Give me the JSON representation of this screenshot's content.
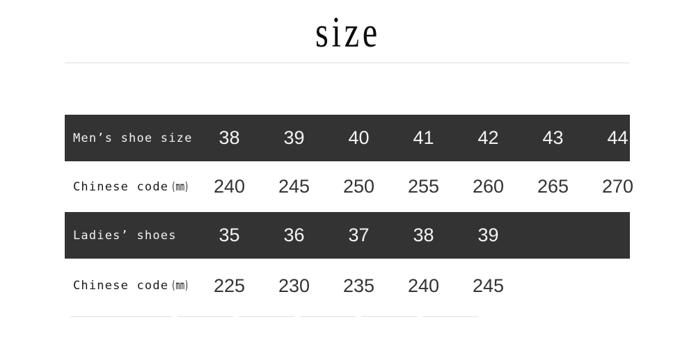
{
  "header": {
    "title": "size"
  },
  "table": {
    "rows": [
      {
        "style": "dark",
        "label": "Men’s shoe size",
        "unit": "",
        "values": [
          "38",
          "39",
          "40",
          "41",
          "42",
          "43",
          "44"
        ]
      },
      {
        "style": "light",
        "label": "Chinese code",
        "unit": "(mm)",
        "values": [
          "240",
          "245",
          "250",
          "255",
          "260",
          "265",
          "270"
        ]
      },
      {
        "style": "dark",
        "label": "Ladies’ shoes",
        "unit": "",
        "values": [
          "35",
          "36",
          "37",
          "38",
          "39",
          "",
          ""
        ]
      },
      {
        "style": "light",
        "label": "Chinese code",
        "unit": "(mm)",
        "values": [
          "225",
          "230",
          "235",
          "240",
          "245",
          "",
          ""
        ]
      }
    ]
  },
  "colors": {
    "dark_row_bg": "#333333",
    "dark_row_text": "#f4f4f4",
    "light_row_text": "#333333",
    "page_bg": "#ffffff",
    "rule": "#dcdcdc",
    "ghost_border": "#e2e2e2"
  }
}
